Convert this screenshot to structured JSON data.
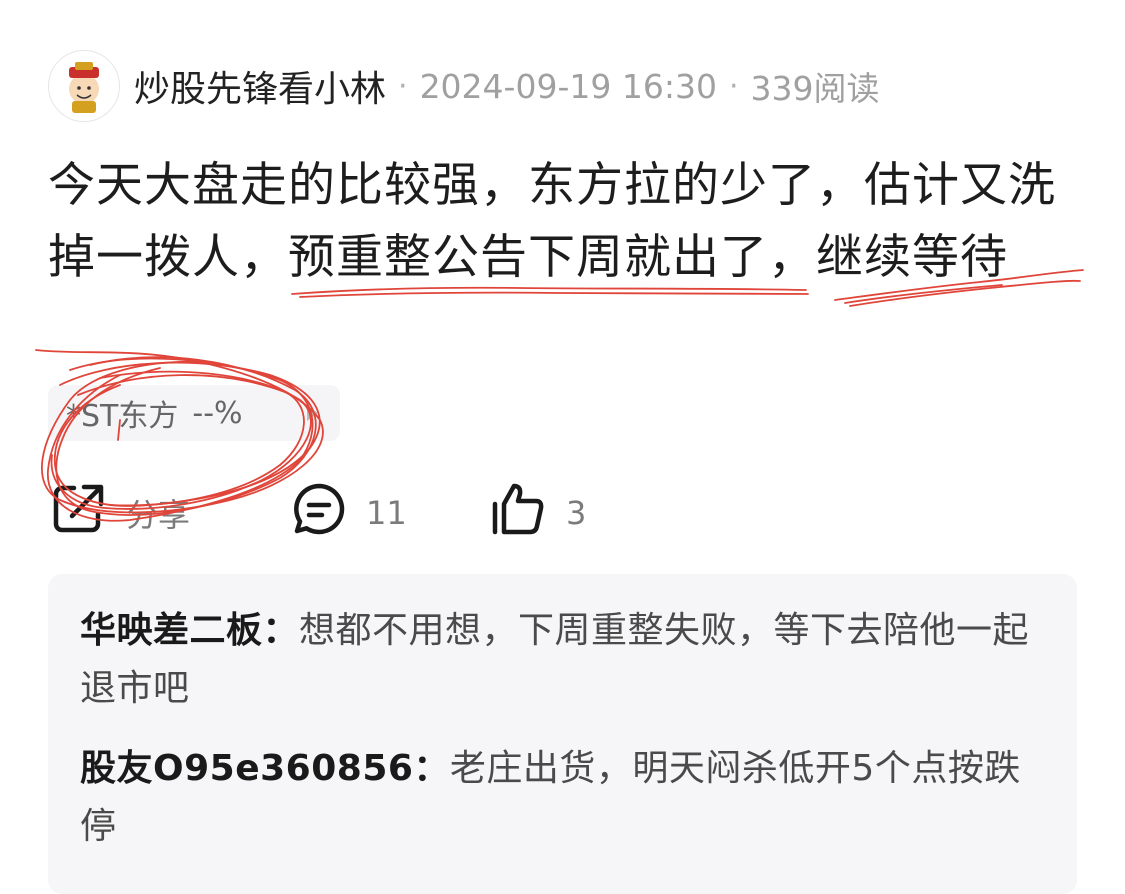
{
  "post": {
    "author": "炒股先锋看小林",
    "datetime": "2024-09-19 16:30",
    "reads": "339阅读",
    "text": "今天大盘走的比较强，东方拉的少了，估计又洗掉一拨人，预重整公告下周就出了，继续等待"
  },
  "stock_tag": {
    "name": "*ST东方",
    "change": "--%"
  },
  "actions": {
    "share_label": "分享",
    "comment_count": "11",
    "like_count": "3"
  },
  "comments": [
    {
      "user": "华映差二板：",
      "text": "想都不用想，下周重整失败，等下去陪他一起退市吧"
    },
    {
      "user": "股友O95e360856：",
      "text": "老庄出货，明天闷杀低开5个点按跌停"
    }
  ],
  "colors": {
    "annotation_red": "#e0453a",
    "meta_gray": "#a0a0a0",
    "comment_bg": "#f6f6f8"
  },
  "icons": [
    "avatar-caishen",
    "share-icon",
    "comment-icon",
    "like-icon",
    "chevron-right-icon"
  ]
}
